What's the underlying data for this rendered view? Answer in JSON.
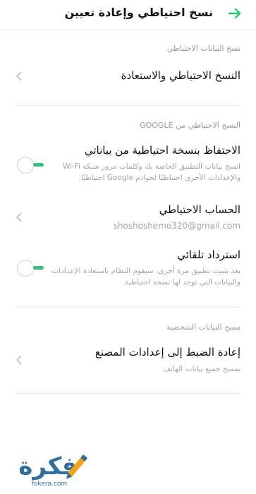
{
  "header": {
    "title": "نسخ احتياطي وإعادة تعيين",
    "back_icon": "arrow-right-icon",
    "accent": "#2fc27a"
  },
  "sections": {
    "backup_data": {
      "label": "نسخ البيانات الاحتياطي",
      "item": {
        "title": "النسخ الاحتياطي والاستعادة"
      }
    },
    "google_backup": {
      "label": "النسخ الاحتياطي من GOOGLE",
      "keep_backup": {
        "title": "الاحتفاظ بنسخة احتياطية من بياناتي",
        "description": "انسخ بيانات التطبيق الخاصة بك وكلمات مرور شبكة Wi-Fi والإعدادات الأخرى احتياطيًا لخوادم Google احتياطيًا."
      },
      "backup_account": {
        "title": "الحساب الاحتياطي",
        "email": "shoshoshemo320@gmail.com"
      },
      "auto_restore": {
        "title": "استرداد تلقائي",
        "description": "بعد تثبيت تطبيق مرة أخرى، سيقوم النظام باستعادة الإعدادات والبيانات التي توجد لها نسخة احتياطية."
      }
    },
    "personal_data": {
      "label": "مسح البيانات الشخصية",
      "factory_reset": {
        "title": "إعادة الضبط إلى إعدادات المصنع",
        "description": "يمسح جميع بيانات الهاتف"
      }
    }
  },
  "watermark": {
    "brand": "فكرة",
    "domain": "fokera.com"
  }
}
